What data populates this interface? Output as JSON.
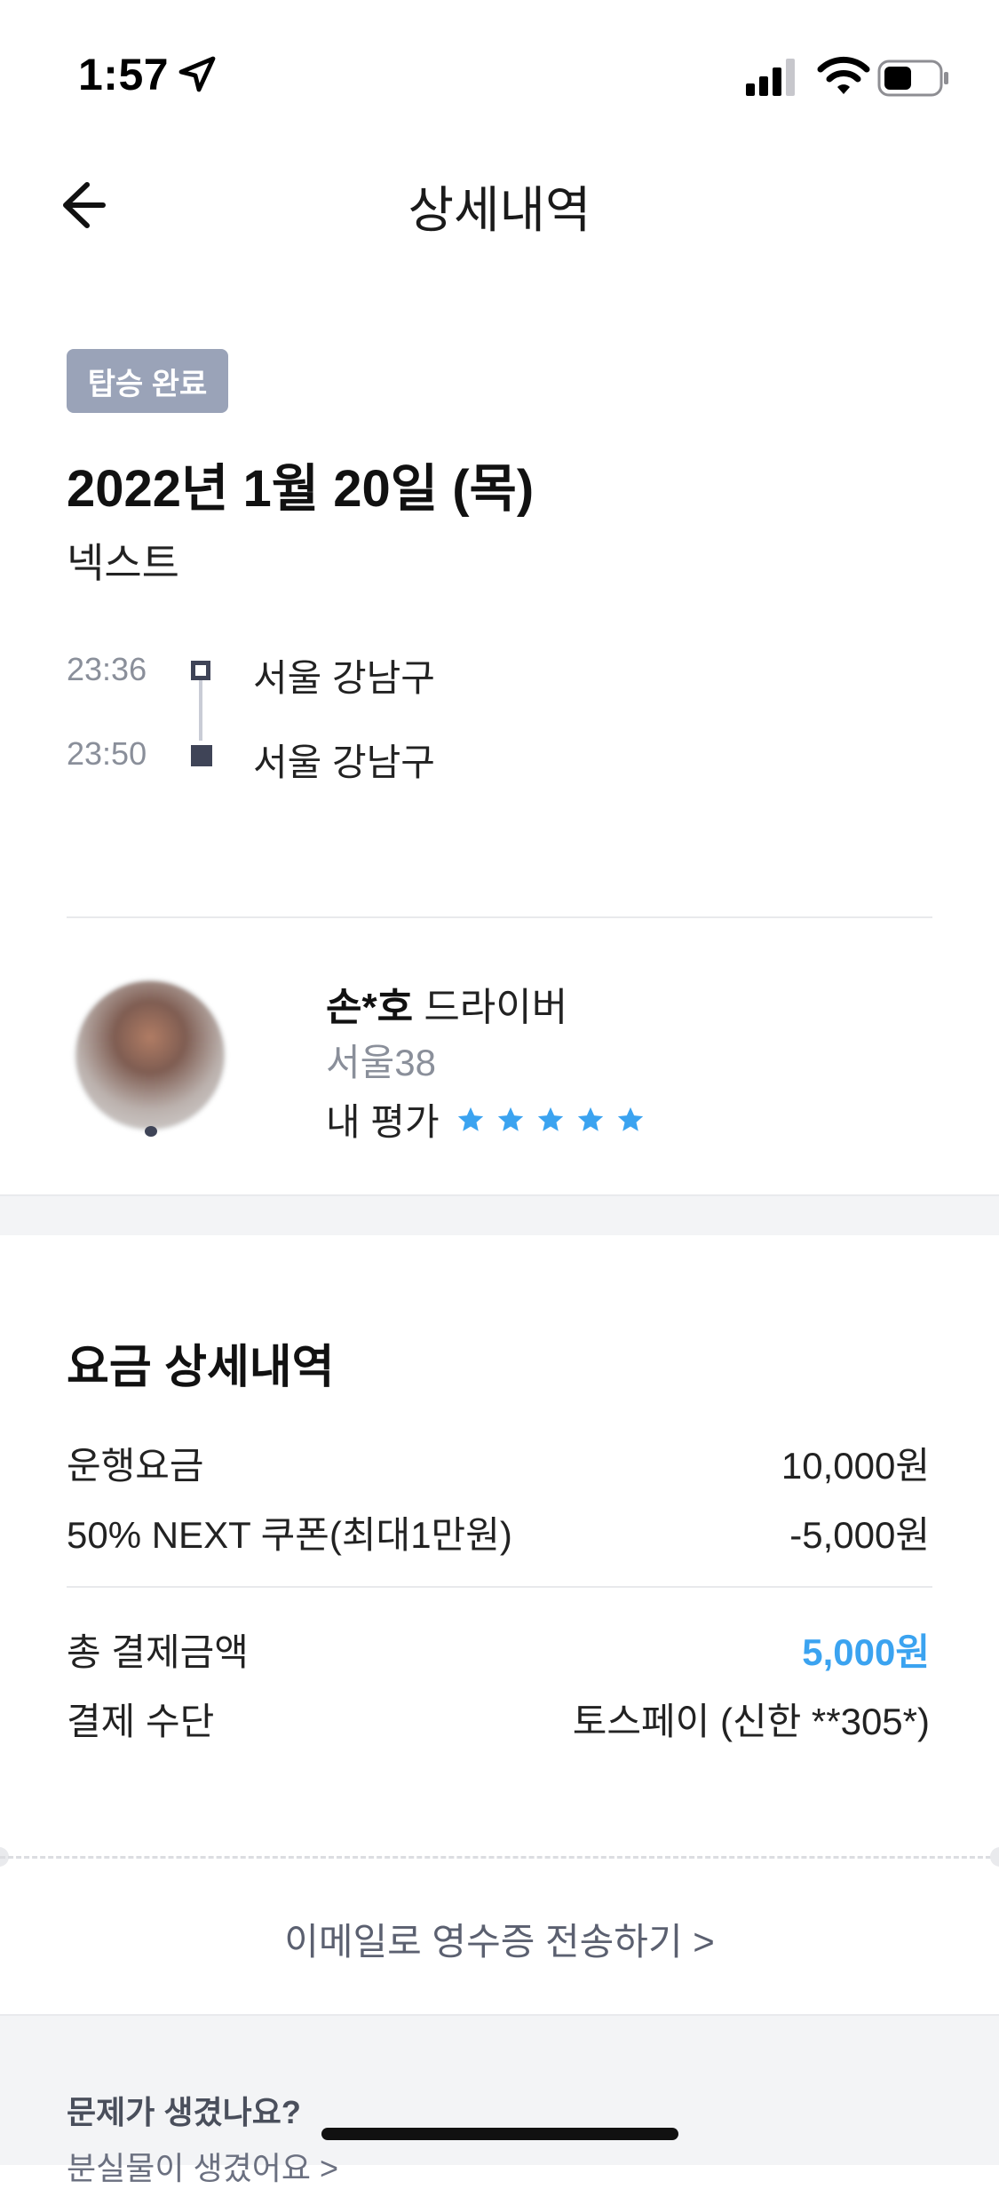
{
  "status_bar": {
    "time": "1:57"
  },
  "nav": {
    "title": "상세내역"
  },
  "ride": {
    "status_badge": "탑승 완료",
    "date": "2022년 1월 20일 (목)",
    "service": "넥스트",
    "route": [
      {
        "time": "23:36",
        "place": "서울 강남구"
      },
      {
        "time": "23:50",
        "place": "서울 강남구"
      }
    ]
  },
  "driver": {
    "name": "손*호",
    "role": "드라이버",
    "plate": "서울38",
    "rating_label": "내 평가",
    "rating": 5,
    "star_color": "#3ba3f0"
  },
  "fare": {
    "title": "요금 상세내역",
    "rows": [
      {
        "label": "운행요금",
        "value": "10,000원"
      },
      {
        "label": "50% NEXT 쿠폰(최대1만원)",
        "value": "-5,000원"
      }
    ],
    "total_label": "총 결제금액",
    "total_value": "5,000원",
    "total_color": "#3ba3f0",
    "payment_label": "결제 수단",
    "payment_value": "토스페이 (신한 **305*)"
  },
  "receipt_link": "이메일로 영수증 전송하기 >",
  "help": {
    "title": "문제가 생겼나요?",
    "subtitle": "분실물이 생겼어요 >"
  },
  "icons": {
    "location": "location-arrow-icon",
    "signal": "cellular-signal-icon",
    "wifi": "wifi-icon",
    "battery": "battery-icon",
    "back": "back-arrow-icon",
    "star": "star-icon"
  }
}
